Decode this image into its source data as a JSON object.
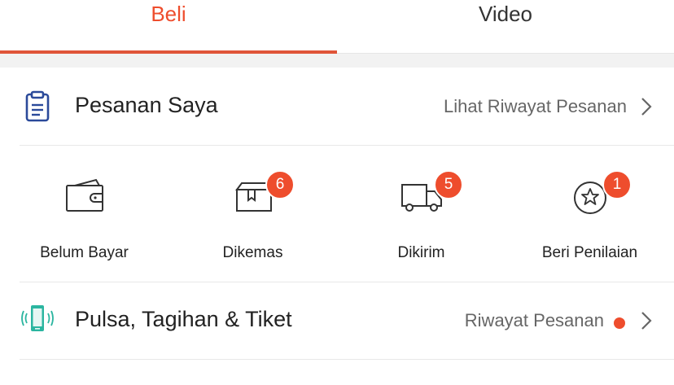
{
  "tabs": {
    "beli": "Beli",
    "video": "Video",
    "active": "Beli"
  },
  "orders": {
    "title": "Pesanan Saya",
    "history_link": "Lihat Riwayat Pesanan",
    "statuses": [
      {
        "label": "Belum Bayar",
        "icon": "wallet-icon",
        "badge": ""
      },
      {
        "label": "Dikemas",
        "icon": "package-box-icon",
        "badge": "6"
      },
      {
        "label": "Dikirim",
        "icon": "delivery-truck-icon",
        "badge": "5"
      },
      {
        "label": "Beri Penilaian",
        "icon": "star-rating-icon",
        "badge": "1"
      }
    ]
  },
  "pulsa": {
    "title": "Pulsa, Tagihan & Tiket",
    "history_link": "Riwayat Pesanan",
    "icon": "mobile-phone-icon"
  },
  "colors": {
    "accent": "#ee4d2d",
    "order_icon": "#2b4a9a",
    "phone_icon": "#2bb5a0"
  }
}
